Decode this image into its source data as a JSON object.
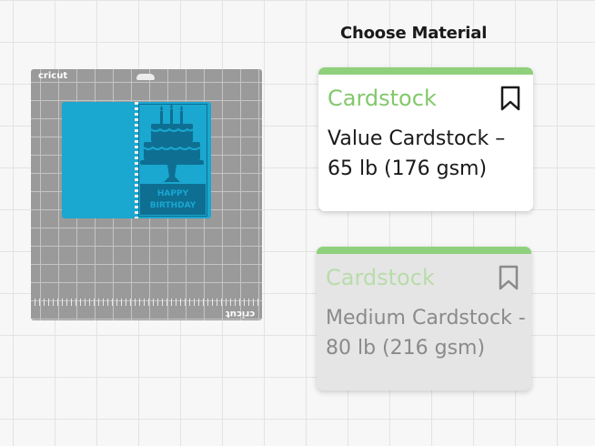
{
  "panel": {
    "title": "Choose Material"
  },
  "mat": {
    "brand": "cricut",
    "brand_mirrored": "cricut"
  },
  "design": {
    "text_line1": "HAPPY",
    "text_line2": "BIRTHDAY",
    "color": "#1aa7d0"
  },
  "materials": [
    {
      "category": "Cardstock",
      "name": "Value Cardstock – 65 lb (176 gsm)",
      "icon": "bookmark-icon",
      "state": "selected"
    },
    {
      "category": "Cardstock",
      "name": "Medium Cardstock - 80 lb (216 gsm)",
      "icon": "bookmark-icon",
      "state": "inactive"
    }
  ],
  "colors": {
    "accent_green": "#8fd07c",
    "category_green": "#82c86b"
  }
}
